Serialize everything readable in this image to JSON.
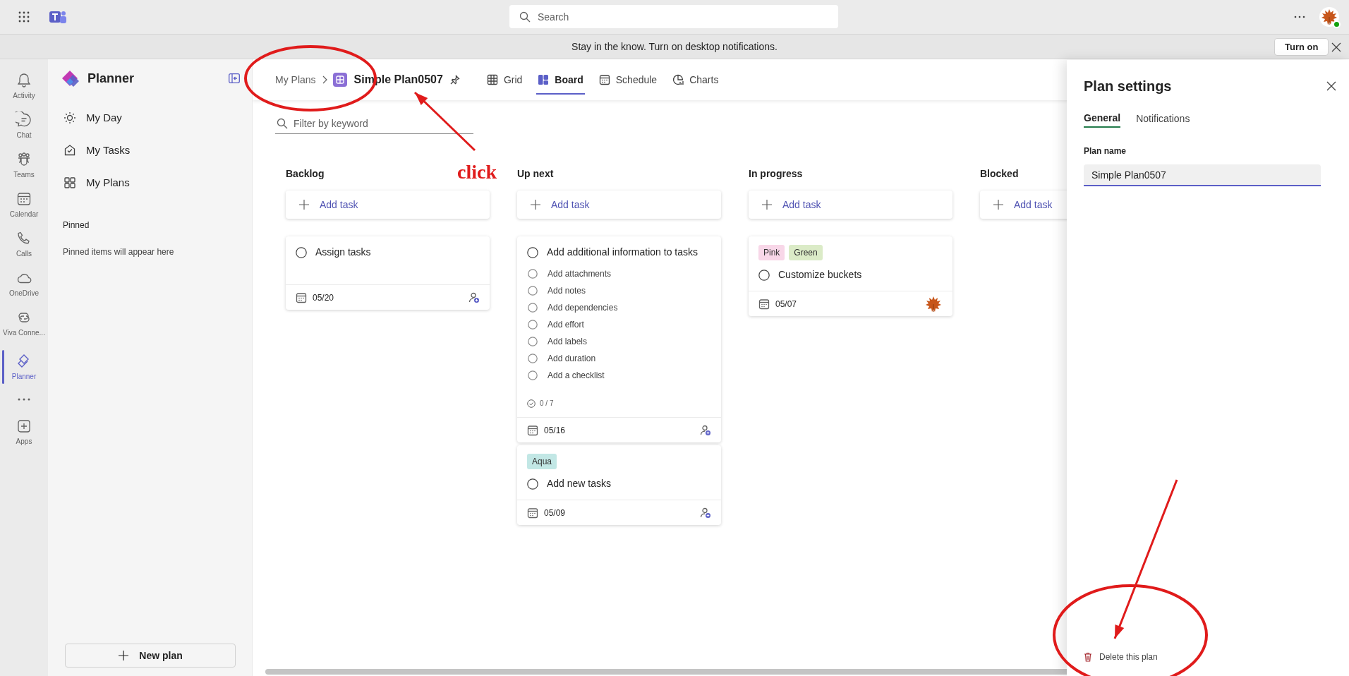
{
  "top_bar": {
    "search": {
      "placeholder": "Search"
    }
  },
  "notification_bar": {
    "text": "Stay in the know. Turn on desktop notifications.",
    "button": "Turn on"
  },
  "app_rail": [
    {
      "label": "Activity",
      "selected": false
    },
    {
      "label": "Chat",
      "selected": false
    },
    {
      "label": "Teams",
      "selected": false
    },
    {
      "label": "Calendar",
      "selected": false
    },
    {
      "label": "Calls",
      "selected": false
    },
    {
      "label": "OneDrive",
      "selected": false
    },
    {
      "label": "Viva Conne...",
      "selected": false
    },
    {
      "label": "Planner",
      "selected": true
    },
    {
      "label": "Apps",
      "selected": false
    }
  ],
  "sidebar": {
    "title": "Planner",
    "items": [
      {
        "label": "My Day"
      },
      {
        "label": "My Tasks"
      },
      {
        "label": "My Plans"
      }
    ],
    "pinned_heading": "Pinned",
    "pinned_empty": "Pinned items will appear here",
    "new_plan": "New plan"
  },
  "header": {
    "breadcrumb": "My Plans",
    "plan_title": "Simple Plan0507",
    "tabs": [
      {
        "label": "Grid",
        "selected": false
      },
      {
        "label": "Board",
        "selected": true
      },
      {
        "label": "Schedule",
        "selected": false
      },
      {
        "label": "Charts",
        "selected": false
      }
    ]
  },
  "filter": {
    "placeholder": "Filter by keyword"
  },
  "buckets": [
    {
      "name": "Backlog",
      "add_task": "Add task",
      "tasks": [
        {
          "title": "Assign tasks",
          "completed": false,
          "date": "05/20",
          "assigned": false
        }
      ]
    },
    {
      "name": "Up next",
      "add_task": "Add task",
      "tasks": [
        {
          "title": "Add additional information to tasks",
          "completed": false,
          "checklist": [
            {
              "text": "Add attachments",
              "checked": false
            },
            {
              "text": "Add notes",
              "checked": false
            },
            {
              "text": "Add dependencies",
              "checked": false
            },
            {
              "text": "Add effort",
              "checked": false
            },
            {
              "text": "Add labels",
              "checked": false
            },
            {
              "text": "Add duration",
              "checked": false
            },
            {
              "text": "Add a checklist",
              "checked": false
            }
          ],
          "checklist_count": "0 / 7",
          "date": "05/16",
          "assigned": false
        },
        {
          "title": "Add new tasks",
          "completed": false,
          "labels": [
            {
              "text": "Aqua",
              "color": "#c2e7e5"
            }
          ],
          "date": "05/09",
          "assigned": false
        }
      ]
    },
    {
      "name": "In progress",
      "add_task": "Add task",
      "tasks": [
        {
          "title": "Customize buckets",
          "completed": false,
          "labels": [
            {
              "text": "Pink",
              "color": "#f8d7e8"
            },
            {
              "text": "Green",
              "color": "#dbebc7"
            }
          ],
          "date": "05/07",
          "assigned": true
        }
      ]
    },
    {
      "name": "Blocked",
      "add_task": "Add task"
    }
  ],
  "settings_panel": {
    "title": "Plan settings",
    "tabs": [
      {
        "label": "General",
        "selected": true
      },
      {
        "label": "Notifications",
        "selected": false
      }
    ],
    "field_label": "Plan name",
    "field_value": "Simple Plan0507",
    "delete": "Delete this plan"
  },
  "annotations": [
    {
      "kind": "ellipse"
    },
    {
      "kind": "arrow"
    },
    {
      "kind": "label",
      "text": "click"
    },
    {
      "kind": "arrow"
    },
    {
      "kind": "ellipse"
    }
  ]
}
